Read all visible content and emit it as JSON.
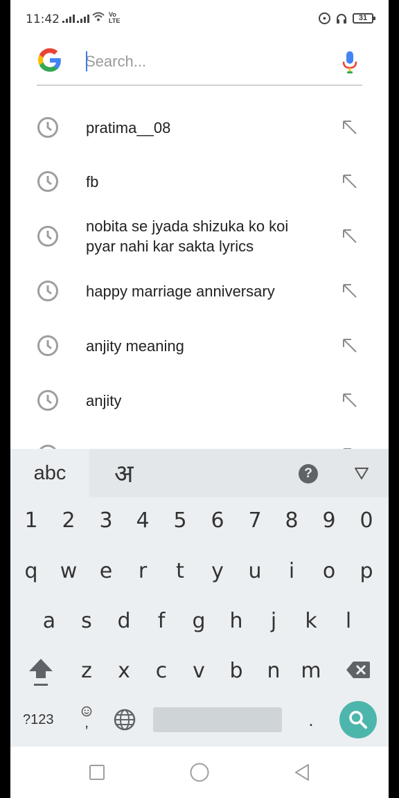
{
  "status_bar": {
    "time": "11:42",
    "volte_top": "Vo",
    "volte_bottom": "LTE",
    "battery": "31",
    "icons": [
      "signal-icon",
      "signal-icon",
      "wifi-icon",
      "volte-icon",
      "lock-rotation-icon",
      "headset-icon",
      "battery-icon"
    ]
  },
  "search": {
    "placeholder": "Search...",
    "value": ""
  },
  "suggestions": [
    {
      "text": "pratima__08"
    },
    {
      "text": "fb"
    },
    {
      "text": "nobita se jyada shizuka ko koi pyar nahi kar sakta lyrics"
    },
    {
      "text": "happy marriage anniversary"
    },
    {
      "text": "anjity meaning"
    },
    {
      "text": "anjity"
    }
  ],
  "keyboard": {
    "lang_abc": "abc",
    "lang_hindi": "अ",
    "help": "?",
    "numbers": [
      "1",
      "2",
      "3",
      "4",
      "5",
      "6",
      "7",
      "8",
      "9",
      "0"
    ],
    "row1": [
      "q",
      "w",
      "e",
      "r",
      "t",
      "y",
      "u",
      "i",
      "o",
      "p"
    ],
    "row2": [
      "a",
      "s",
      "d",
      "f",
      "g",
      "h",
      "j",
      "k",
      "l"
    ],
    "row3": [
      "z",
      "x",
      "c",
      "v",
      "b",
      "n",
      "m"
    ],
    "symbols": "?123",
    "comma": ",",
    "period": "."
  },
  "colors": {
    "accent_blue": "#3b78e7",
    "search_key": "#4db6ac",
    "google_blue": "#4285F4",
    "google_red": "#EA4335",
    "google_yellow": "#FBBC05",
    "google_green": "#34A853"
  }
}
